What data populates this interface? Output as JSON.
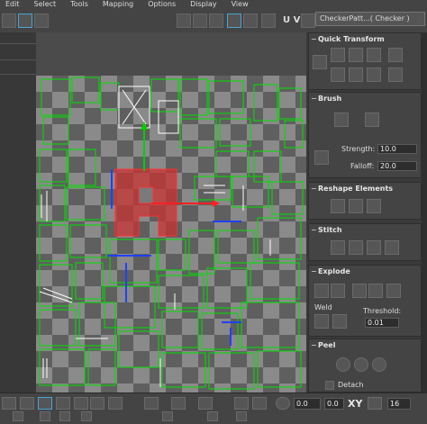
{
  "menubar": {
    "items": [
      "Edit",
      "Select",
      "Tools",
      "Mapping",
      "Options",
      "Display",
      "View"
    ]
  },
  "toolbar": {
    "uv_label": "U V",
    "checker_dropdown": "CheckerPatt...( Checker )"
  },
  "panel": {
    "quick_transform": {
      "title": "Quick Transform",
      "collapse": "−"
    },
    "brush": {
      "title": "Brush",
      "collapse": "−",
      "strength_label": "Strength:",
      "strength_value": "10.0",
      "falloff_label": "Falloff:",
      "falloff_value": "20.0"
    },
    "reshape": {
      "title": "Reshape Elements",
      "collapse": "−"
    },
    "stitch": {
      "title": "Stitch",
      "collapse": "−"
    },
    "explode": {
      "title": "Explode",
      "collapse": "−",
      "weld_label": "Weld",
      "threshold_label": "Threshold:",
      "threshold_value": "0.01"
    },
    "peel": {
      "title": "Peel",
      "collapse": "−",
      "detach_label": "Detach"
    }
  },
  "bottombar": {
    "field1_value": "0.0",
    "field2_value": "0.0",
    "xy_label": "XY",
    "grid_value": "16"
  },
  "colors": {
    "selection_red": "#c83232",
    "uv_green": "#00e000",
    "uv_blue": "#2040ff",
    "accent": "#4aa3d8"
  }
}
